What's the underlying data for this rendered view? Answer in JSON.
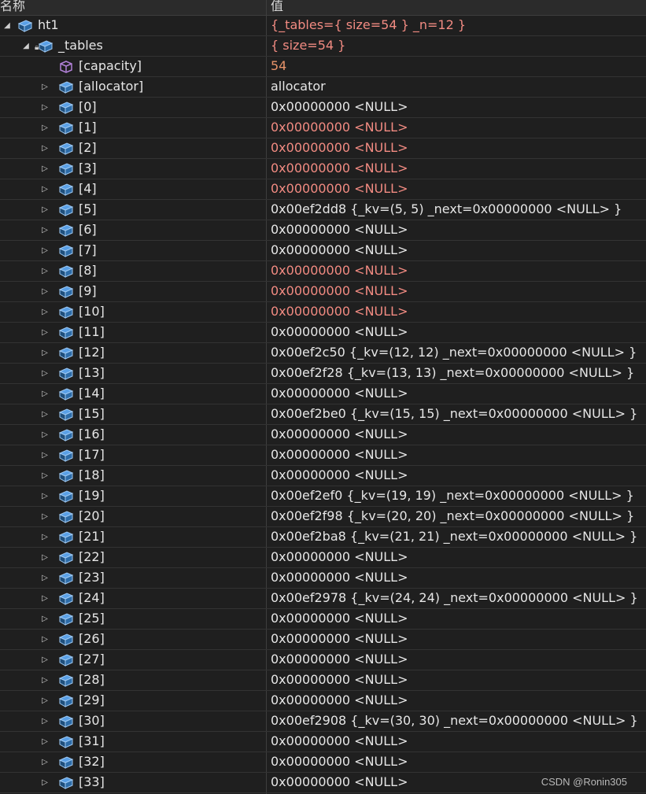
{
  "header": {
    "name": "名称",
    "value": "值"
  },
  "rows": [
    {
      "name": "ht1",
      "value": "{_tables={ size=54 } _n=12 }",
      "level": 0,
      "expander": "open",
      "icon": "field",
      "valueColor": "changed"
    },
    {
      "name": "_tables",
      "value": "{ size=54 }",
      "level": 1,
      "expander": "open",
      "icon": "private-field",
      "valueColor": "changed"
    },
    {
      "name": "[capacity]",
      "value": "54",
      "level": 2,
      "expander": "none",
      "icon": "raw-view",
      "valueColor": "orange"
    },
    {
      "name": "[allocator]",
      "value": "allocator",
      "level": 2,
      "expander": "closed",
      "icon": "field",
      "valueColor": "normal"
    },
    {
      "name": "[0]",
      "value": "0x00000000 <NULL>",
      "level": 2,
      "expander": "closed",
      "icon": "field",
      "valueColor": "normal"
    },
    {
      "name": "[1]",
      "value": "0x00000000 <NULL>",
      "level": 2,
      "expander": "closed",
      "icon": "field",
      "valueColor": "changed"
    },
    {
      "name": "[2]",
      "value": "0x00000000 <NULL>",
      "level": 2,
      "expander": "closed",
      "icon": "field",
      "valueColor": "changed"
    },
    {
      "name": "[3]",
      "value": "0x00000000 <NULL>",
      "level": 2,
      "expander": "closed",
      "icon": "field",
      "valueColor": "changed"
    },
    {
      "name": "[4]",
      "value": "0x00000000 <NULL>",
      "level": 2,
      "expander": "closed",
      "icon": "field",
      "valueColor": "changed"
    },
    {
      "name": "[5]",
      "value": "0x00ef2dd8 {_kv=(5, 5) _next=0x00000000 <NULL> }",
      "level": 2,
      "expander": "closed",
      "icon": "field",
      "valueColor": "normal"
    },
    {
      "name": "[6]",
      "value": "0x00000000 <NULL>",
      "level": 2,
      "expander": "closed",
      "icon": "field",
      "valueColor": "normal"
    },
    {
      "name": "[7]",
      "value": "0x00000000 <NULL>",
      "level": 2,
      "expander": "closed",
      "icon": "field",
      "valueColor": "normal"
    },
    {
      "name": "[8]",
      "value": "0x00000000 <NULL>",
      "level": 2,
      "expander": "closed",
      "icon": "field",
      "valueColor": "changed"
    },
    {
      "name": "[9]",
      "value": "0x00000000 <NULL>",
      "level": 2,
      "expander": "closed",
      "icon": "field",
      "valueColor": "changed"
    },
    {
      "name": "[10]",
      "value": "0x00000000 <NULL>",
      "level": 2,
      "expander": "closed",
      "icon": "field",
      "valueColor": "changed"
    },
    {
      "name": "[11]",
      "value": "0x00000000 <NULL>",
      "level": 2,
      "expander": "closed",
      "icon": "field",
      "valueColor": "normal"
    },
    {
      "name": "[12]",
      "value": "0x00ef2c50 {_kv=(12, 12) _next=0x00000000 <NULL> }",
      "level": 2,
      "expander": "closed",
      "icon": "field",
      "valueColor": "normal"
    },
    {
      "name": "[13]",
      "value": "0x00ef2f28 {_kv=(13, 13) _next=0x00000000 <NULL> }",
      "level": 2,
      "expander": "closed",
      "icon": "field",
      "valueColor": "normal"
    },
    {
      "name": "[14]",
      "value": "0x00000000 <NULL>",
      "level": 2,
      "expander": "closed",
      "icon": "field",
      "valueColor": "normal"
    },
    {
      "name": "[15]",
      "value": "0x00ef2be0 {_kv=(15, 15) _next=0x00000000 <NULL> }",
      "level": 2,
      "expander": "closed",
      "icon": "field",
      "valueColor": "normal"
    },
    {
      "name": "[16]",
      "value": "0x00000000 <NULL>",
      "level": 2,
      "expander": "closed",
      "icon": "field",
      "valueColor": "normal"
    },
    {
      "name": "[17]",
      "value": "0x00000000 <NULL>",
      "level": 2,
      "expander": "closed",
      "icon": "field",
      "valueColor": "normal"
    },
    {
      "name": "[18]",
      "value": "0x00000000 <NULL>",
      "level": 2,
      "expander": "closed",
      "icon": "field",
      "valueColor": "normal"
    },
    {
      "name": "[19]",
      "value": "0x00ef2ef0 {_kv=(19, 19) _next=0x00000000 <NULL> }",
      "level": 2,
      "expander": "closed",
      "icon": "field",
      "valueColor": "normal"
    },
    {
      "name": "[20]",
      "value": "0x00ef2f98 {_kv=(20, 20) _next=0x00000000 <NULL> }",
      "level": 2,
      "expander": "closed",
      "icon": "field",
      "valueColor": "normal"
    },
    {
      "name": "[21]",
      "value": "0x00ef2ba8 {_kv=(21, 21) _next=0x00000000 <NULL> }",
      "level": 2,
      "expander": "closed",
      "icon": "field",
      "valueColor": "normal"
    },
    {
      "name": "[22]",
      "value": "0x00000000 <NULL>",
      "level": 2,
      "expander": "closed",
      "icon": "field",
      "valueColor": "normal"
    },
    {
      "name": "[23]",
      "value": "0x00000000 <NULL>",
      "level": 2,
      "expander": "closed",
      "icon": "field",
      "valueColor": "normal"
    },
    {
      "name": "[24]",
      "value": "0x00ef2978 {_kv=(24, 24) _next=0x00000000 <NULL> }",
      "level": 2,
      "expander": "closed",
      "icon": "field",
      "valueColor": "normal"
    },
    {
      "name": "[25]",
      "value": "0x00000000 <NULL>",
      "level": 2,
      "expander": "closed",
      "icon": "field",
      "valueColor": "normal"
    },
    {
      "name": "[26]",
      "value": "0x00000000 <NULL>",
      "level": 2,
      "expander": "closed",
      "icon": "field",
      "valueColor": "normal"
    },
    {
      "name": "[27]",
      "value": "0x00000000 <NULL>",
      "level": 2,
      "expander": "closed",
      "icon": "field",
      "valueColor": "normal"
    },
    {
      "name": "[28]",
      "value": "0x00000000 <NULL>",
      "level": 2,
      "expander": "closed",
      "icon": "field",
      "valueColor": "normal"
    },
    {
      "name": "[29]",
      "value": "0x00000000 <NULL>",
      "level": 2,
      "expander": "closed",
      "icon": "field",
      "valueColor": "normal"
    },
    {
      "name": "[30]",
      "value": "0x00ef2908 {_kv=(30, 30) _next=0x00000000 <NULL> }",
      "level": 2,
      "expander": "closed",
      "icon": "field",
      "valueColor": "normal"
    },
    {
      "name": "[31]",
      "value": "0x00000000 <NULL>",
      "level": 2,
      "expander": "closed",
      "icon": "field",
      "valueColor": "normal"
    },
    {
      "name": "[32]",
      "value": "0x00000000 <NULL>",
      "level": 2,
      "expander": "closed",
      "icon": "field",
      "valueColor": "normal"
    },
    {
      "name": "[33]",
      "value": "0x00000000 <NULL>",
      "level": 2,
      "expander": "closed",
      "icon": "field",
      "valueColor": "normal"
    }
  ],
  "watermark": "CSDN @Ronin305",
  "colors": {
    "changed": "#f28b82",
    "orange": "#e8946a",
    "field_icon": "#5aa0e6",
    "raw_view_icon": "#b180d7"
  }
}
